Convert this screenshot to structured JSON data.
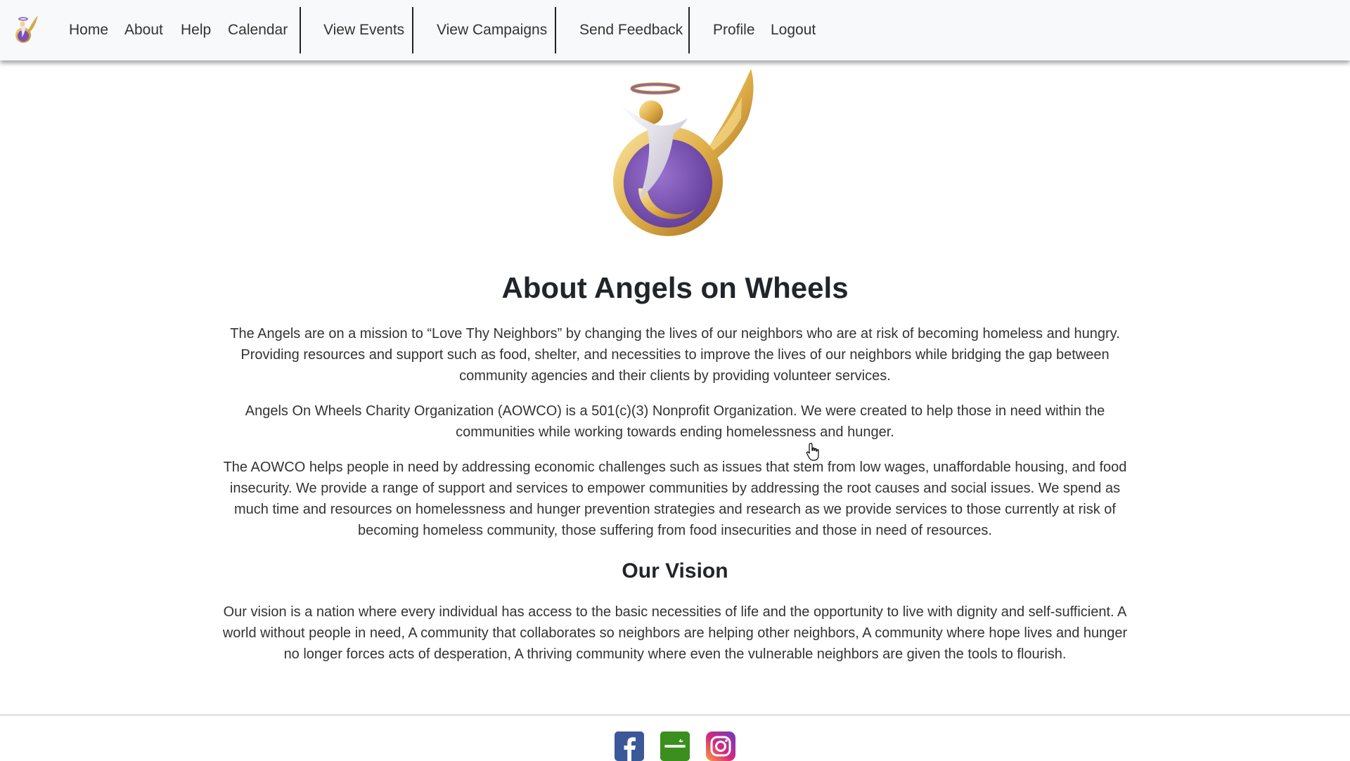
{
  "navbar": {
    "brand_icon": "angels-on-wheels-logo-icon",
    "links": {
      "home": "Home",
      "about": "About",
      "help": "Help",
      "calendar": "Calendar",
      "view_events": "View Events",
      "view_campaigns": "View Campaigns",
      "send_feedback": "Send Feedback",
      "profile": "Profile",
      "logout": "Logout"
    },
    "background_color": "#f8f9fa"
  },
  "main": {
    "hero_logo_icon": "angel-wings-logo-icon",
    "title": "About Angels on Wheels",
    "paragraphs": {
      "mission": "The Angels are on a mission to “Love Thy Neighbors” by changing the lives of our neighbors who are at risk of becoming homeless and hungry. Providing resources and support such as food, shelter, and necessities to improve the lives of our neighbors while bridging the gap between community agencies and their clients by providing volunteer services.",
      "org": "Angels On Wheels Charity Organization (AOWCO) is a 501(c)(3) Nonprofit Organization. We were created to help those in need within the communities while working towards ending homelessness and hunger.",
      "help": "The AOWCO helps people in need by addressing economic challenges such as issues that stem from low wages, unaffordable housing, and food insecurity. We provide a range of support and services to empower communities by addressing the root causes and social issues. We spend as much time and resources on homelessness and hunger prevention strategies and research as we provide services to those currently at risk of becoming homeless community, those suffering from food insecurities and those in need of resources."
    },
    "vision_title": "Our Vision",
    "vision_text": "Our vision is a nation where every individual has access to the basic necessities of life and the opportunity to live with dignity and self-sufficient. A world without people in need, A community that collaborates so neighbors are helping other neighbors, A community where hope lives and hunger no longer forces acts of desperation, A thriving community where even the vulnerable neighbors are given the tools to flourish."
  },
  "footer": {
    "social": [
      {
        "icon": "facebook-icon",
        "color": "#3b5998"
      },
      {
        "icon": "gofundme-icon",
        "color": "#3a8f1e"
      },
      {
        "icon": "instagram-icon",
        "color": "#c13584"
      }
    ]
  },
  "colors": {
    "logo_purple": "#7b4fb3",
    "logo_gold": "#d9a93c",
    "text": "#333333",
    "heading": "#212529"
  }
}
